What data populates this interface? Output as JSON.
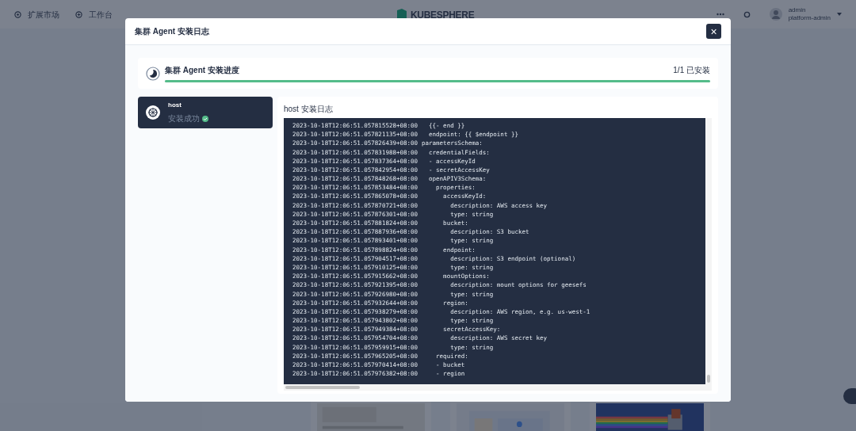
{
  "topbar": {
    "nav": [
      {
        "label": "扩展市场",
        "kind": "store"
      },
      {
        "label": "工作台",
        "kind": "grid"
      }
    ],
    "logo": "KUBESPHERE",
    "user": {
      "name": "admin",
      "role": "platform-admin"
    }
  },
  "dialog": {
    "title": "集群 Agent 安装日志",
    "close": "×",
    "progress": {
      "title": "集群 Agent 安装进度",
      "count": "1/1 已安装",
      "level": 1
    },
    "clusters": [
      {
        "name": "host",
        "status": "安装成功",
        "success": true,
        "selected": true
      }
    ],
    "log": {
      "title": "host 安装日志",
      "lines": [
        {
          "ts": "2023-10-18T12:06:51.057815528+08:00",
          "text": "    {{- end }}"
        },
        {
          "ts": "2023-10-18T12:06:51.057821135+08:00",
          "text": "    endpoint: {{ $endpoint }}"
        },
        {
          "ts": "2023-10-18T12:06:51.057826439+08:00",
          "text": "  parametersSchema:"
        },
        {
          "ts": "2023-10-18T12:06:51.057831988+08:00",
          "text": "    credentialFields:"
        },
        {
          "ts": "2023-10-18T12:06:51.057837364+08:00",
          "text": "    - accessKeyId"
        },
        {
          "ts": "2023-10-18T12:06:51.057842954+08:00",
          "text": "    - secretAccessKey"
        },
        {
          "ts": "2023-10-18T12:06:51.057848268+08:00",
          "text": "    openAPIV3Schema:"
        },
        {
          "ts": "2023-10-18T12:06:51.057853484+08:00",
          "text": "      properties:"
        },
        {
          "ts": "2023-10-18T12:06:51.057865078+08:00",
          "text": "        accessKeyId:"
        },
        {
          "ts": "2023-10-18T12:06:51.057870721+08:00",
          "text": "          description: AWS access key"
        },
        {
          "ts": "2023-10-18T12:06:51.057876301+08:00",
          "text": "          type: string"
        },
        {
          "ts": "2023-10-18T12:06:51.057881824+08:00",
          "text": "        bucket:"
        },
        {
          "ts": "2023-10-18T12:06:51.057887936+08:00",
          "text": "          description: S3 bucket"
        },
        {
          "ts": "2023-10-18T12:06:51.057893401+08:00",
          "text": "          type: string"
        },
        {
          "ts": "2023-10-18T12:06:51.057898824+08:00",
          "text": "        endpoint:"
        },
        {
          "ts": "2023-10-18T12:06:51.057904517+08:00",
          "text": "          description: S3 endpoint (optional)"
        },
        {
          "ts": "2023-10-18T12:06:51.057910125+08:00",
          "text": "          type: string"
        },
        {
          "ts": "2023-10-18T12:06:51.057915662+08:00",
          "text": "        mountOptions:"
        },
        {
          "ts": "2023-10-18T12:06:51.057921395+08:00",
          "text": "          description: mount options for geesefs"
        },
        {
          "ts": "2023-10-18T12:06:51.057926980+08:00",
          "text": "          type: string"
        },
        {
          "ts": "2023-10-18T12:06:51.057932644+08:00",
          "text": "        region:"
        },
        {
          "ts": "2023-10-18T12:06:51.057938279+08:00",
          "text": "          description: AWS region, e.g. us-west-1"
        },
        {
          "ts": "2023-10-18T12:06:51.057943802+08:00",
          "text": "          type: string"
        },
        {
          "ts": "2023-10-18T12:06:51.057949384+08:00",
          "text": "        secretAccessKey:"
        },
        {
          "ts": "2023-10-18T12:06:51.057954704+08:00",
          "text": "          description: AWS secret key"
        },
        {
          "ts": "2023-10-18T12:06:51.057959915+08:00",
          "text": "          type: string"
        },
        {
          "ts": "2023-10-18T12:06:51.057965205+08:00",
          "text": "      required:"
        },
        {
          "ts": "2023-10-18T12:06:51.057970414+08:00",
          "text": "      - bucket"
        },
        {
          "ts": "2023-10-18T12:06:51.057976382+08:00",
          "text": "      - region"
        }
      ]
    }
  }
}
